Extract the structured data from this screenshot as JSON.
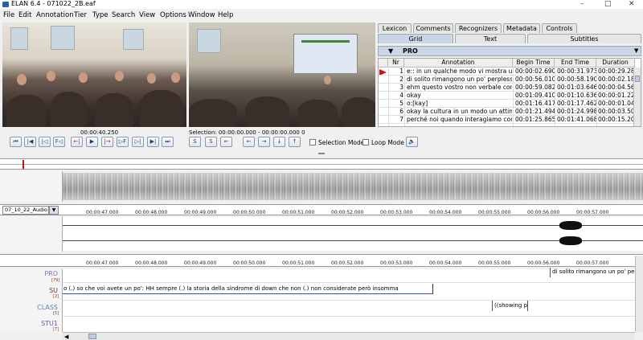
{
  "window": {
    "title": "ELAN 6.4 - 071022_2B.eaf",
    "controls": [
      "–",
      "□",
      "✕"
    ]
  },
  "menu": [
    "File",
    "Edit",
    "Annotation",
    "Tier",
    "Type",
    "Search",
    "View",
    "Options",
    "Window",
    "Help"
  ],
  "right_tabs_top": [
    "Lexicon",
    "Comments",
    "Recognizers",
    "Metadata",
    "Controls"
  ],
  "right_tabs_bottom": [
    "Grid",
    "Text",
    "Subtitles"
  ],
  "tier_select": "PRO",
  "grid": {
    "headers": [
      "",
      "Nr",
      "Annotation",
      "Begin Time",
      "End Time",
      "Duration"
    ],
    "rows": [
      {
        "nr": "1",
        "annotation": "e:: in un qualche modo vi mostra una...",
        "begin": "00:00:02.690",
        "end": "00:00:31.973",
        "dur": "00:00:29.283"
      },
      {
        "nr": "2",
        "annotation": "di solito rimangono un po' perplessi ...",
        "begin": "00:00:56.010",
        "end": "00:00:58.190",
        "dur": "00:00:02.180"
      },
      {
        "nr": "3",
        "annotation": "ehm questo vostro non verbale cond...",
        "begin": "00:00:59.082",
        "end": "00:01:03.646",
        "dur": "00:00:04.564"
      },
      {
        "nr": "4",
        "annotation": "okay",
        "begin": "00:01:09.410",
        "end": "00:01:10.636",
        "dur": "00:00:01.226"
      },
      {
        "nr": "5",
        "annotation": "o:[kay]",
        "begin": "00:01:16.417",
        "end": "00:01:17.462",
        "dur": "00:00:01.045"
      },
      {
        "nr": "6",
        "annotation": "okay la cultura in un modo un attimin...",
        "begin": "00:01:21.494",
        "end": "00:01:24.998",
        "dur": "00:00:03.504"
      },
      {
        "nr": "7",
        "annotation": "perché noi quando interagiamo con ...",
        "begin": "00:01:25.865",
        "end": "00:01:41.068",
        "dur": "00:00:15.203"
      }
    ]
  },
  "timecode": "00:00:40.250",
  "selection": "Selection: 00:00:00.000 - 00:00:00.000  0",
  "controls": {
    "buttons_left": [
      "⏮",
      "|◀",
      "|◁",
      "F◁",
      "←|",
      "▶",
      "|→",
      "▷F",
      "▷|",
      "▶|",
      "⏭"
    ],
    "buttons_mid": [
      "S",
      "S",
      "←"
    ],
    "buttons_arrows": [
      "←",
      "→",
      "↓",
      "↑"
    ],
    "selection_mode": "Selection Mode",
    "loop_mode": "Loop Mode"
  },
  "audio_track": "07_10_22_Audio1...",
  "ruler_ticks": [
    "00:00:47.000",
    "00:00:48.000",
    "00:00:49.000",
    "00:00:50.000",
    "00:00:51.000",
    "00:00:52.000",
    "00:00:53.000",
    "00:00:54.000",
    "00:00:55.000",
    "00:00:56.000",
    "00:00:57.000"
  ],
  "tiers": [
    {
      "name": "PRO",
      "sub": "[79]",
      "color": "#8a6fb0"
    },
    {
      "name": "SU",
      "sub": "[2]",
      "color": "#8a2f2f"
    },
    {
      "name": "CLASS",
      "sub": "[5]",
      "color": "#4a8bb0"
    },
    {
      "name": "STU1",
      "sub": "[7]",
      "color": "#5a5ab0"
    }
  ],
  "annotations": {
    "pro": "di solito rimangono un po' perp",
    "su": "o (.) so che voi avete un po': HH sempre (.) la storia della sindrome di down che non (.) non considerate però insomma",
    "class": "((showing p"
  }
}
